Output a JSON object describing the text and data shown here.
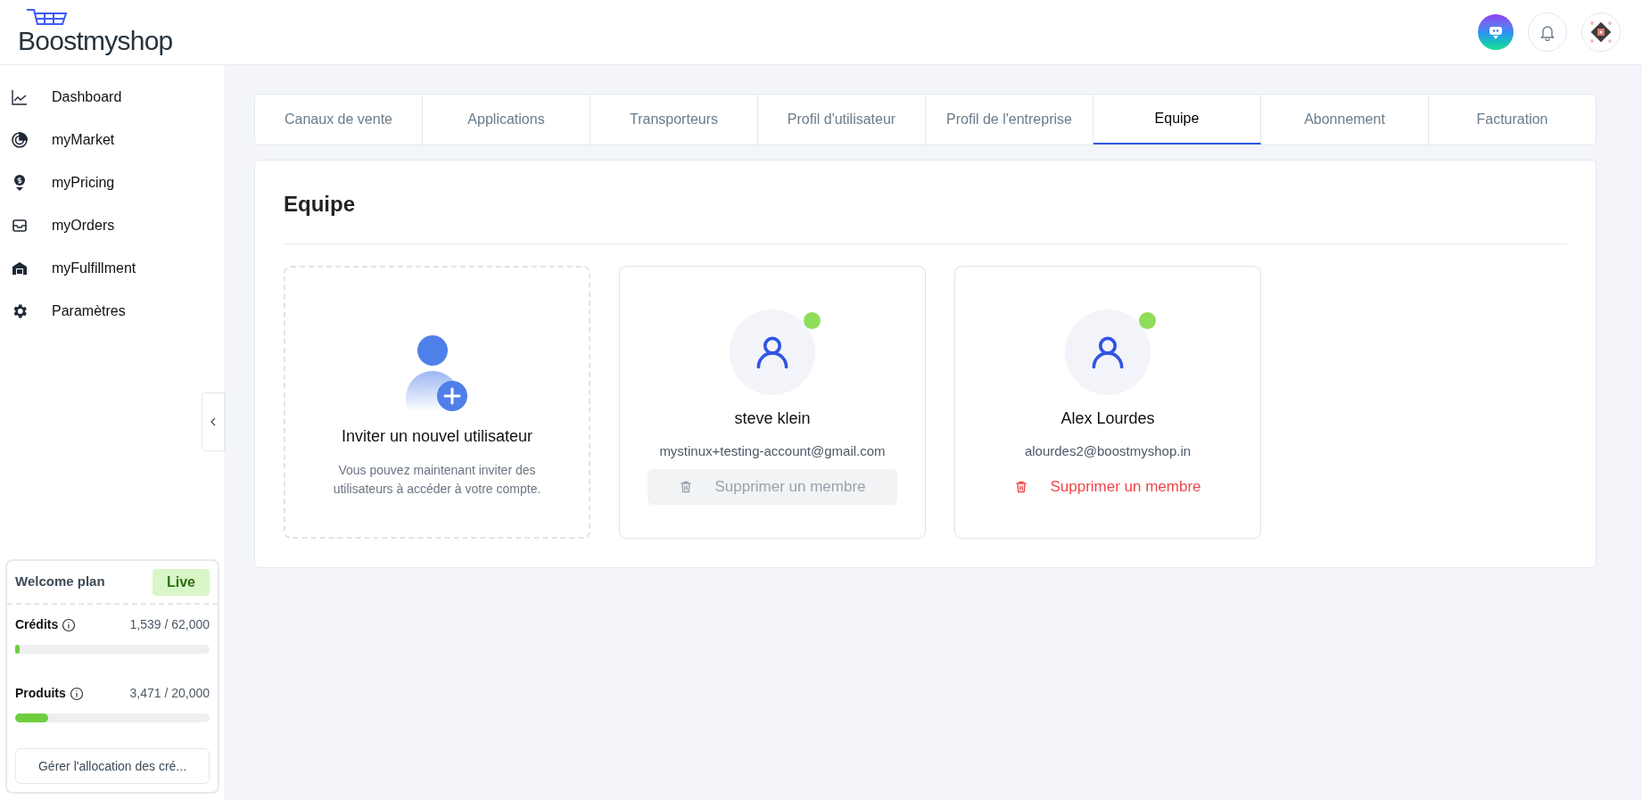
{
  "logo": {
    "text": "Boostmyshop"
  },
  "sidebar": {
    "items": [
      {
        "label": "Dashboard",
        "kind": "chart"
      },
      {
        "label": "myMarket",
        "kind": "radar"
      },
      {
        "label": "myPricing",
        "kind": "pricing"
      },
      {
        "label": "myOrders",
        "kind": "inbox"
      },
      {
        "label": "myFulfillment",
        "kind": "warehouse"
      },
      {
        "label": "Paramètres",
        "kind": "gear"
      }
    ],
    "plan": {
      "name": "Welcome plan",
      "badge": "Live",
      "meters": [
        {
          "label": "Crédits",
          "reading": "1,539 / 62,000",
          "level": 0.025
        },
        {
          "label": "Produits",
          "reading": "3,471 / 20,000",
          "level": 0.17
        }
      ],
      "button": "Gérer l'allocation des cré..."
    }
  },
  "tabs": [
    {
      "label": "Canaux de vente",
      "selected": false
    },
    {
      "label": "Applications",
      "selected": false
    },
    {
      "label": "Transporteurs",
      "selected": false
    },
    {
      "label": "Profil d'utilisateur",
      "selected": false
    },
    {
      "label": "Profil de l'entreprise",
      "selected": false
    },
    {
      "label": "Equipe",
      "selected": true
    },
    {
      "label": "Abonnement",
      "selected": false
    },
    {
      "label": "Facturation",
      "selected": false
    }
  ],
  "panel": {
    "title": "Equipe",
    "invite": {
      "title": "Inviter un nouvel utilisateur",
      "text": "Vous pouvez maintenant inviter des utilisateurs à accéder à votre compte."
    },
    "members": [
      {
        "name": "steve klein",
        "email": "mystinux+testing-account@gmail.com",
        "online": true,
        "delete": {
          "label": "Supprimer un membre",
          "disabled": true
        }
      },
      {
        "name": "Alex Lourdes",
        "email": "alourdes2@boostmyshop.in",
        "online": true,
        "delete": {
          "label": "Supprimer un membre",
          "disabled": false
        }
      }
    ]
  }
}
